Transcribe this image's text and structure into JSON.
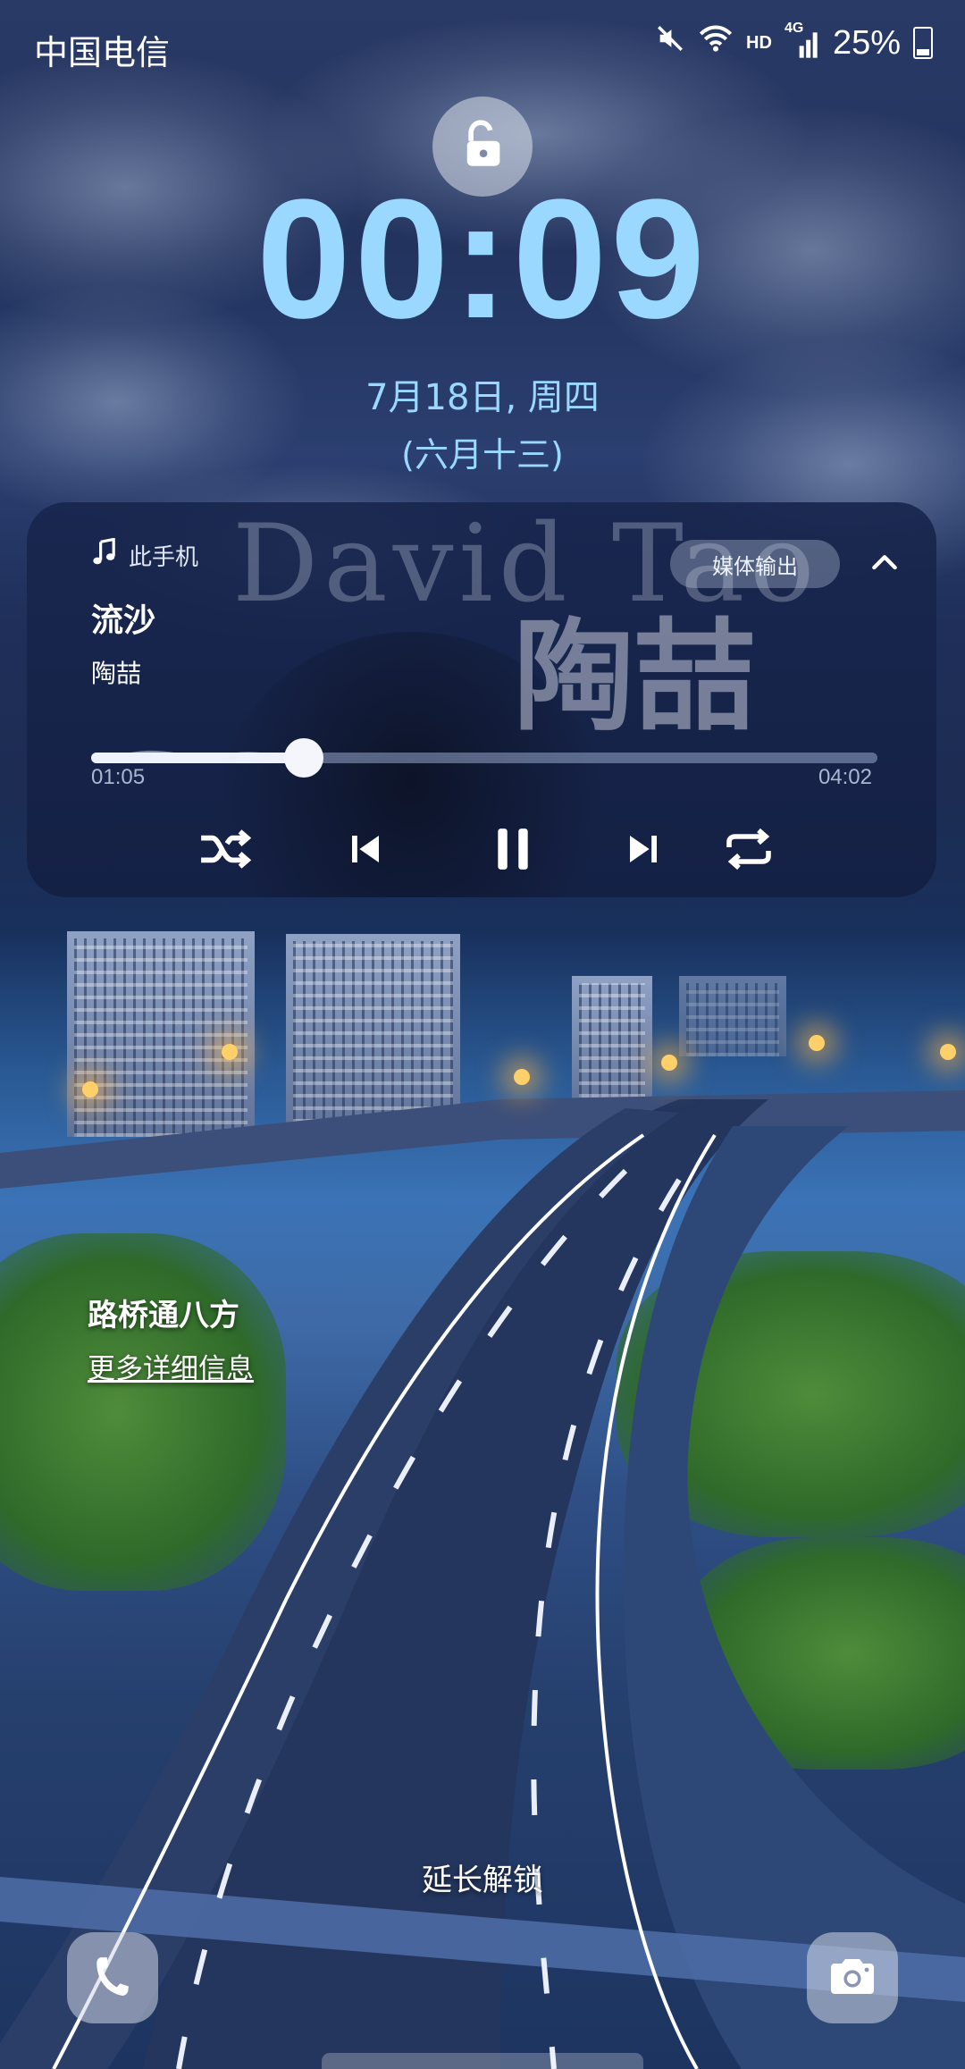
{
  "status_bar": {
    "carrier": "中国电信",
    "hd": "HD",
    "network": "4G",
    "battery_percent": "25%",
    "icons": [
      "mute-icon",
      "wifi-icon",
      "signal-icon",
      "battery-icon"
    ]
  },
  "lock": {
    "icon": "unlock-icon"
  },
  "clock": {
    "time": "00:09",
    "date": "7月18日, 周四",
    "lunar": "(六月十三)"
  },
  "media": {
    "source_label": "此手机",
    "output_button": "媒体输出",
    "song_title": "流沙",
    "artist": "陶喆",
    "elapsed": "01:05",
    "total": "04:02",
    "progress_fraction": 0.27,
    "album_art_text": "David Tao",
    "album_art_cn": "陶喆",
    "controls": [
      "shuffle-icon",
      "previous-icon",
      "pause-icon",
      "next-icon",
      "repeat-icon"
    ]
  },
  "wallpaper": {
    "title": "路桥通八方",
    "link": "更多详细信息"
  },
  "bottom": {
    "hint": "延长解锁",
    "left_shortcut": "phone-icon",
    "right_shortcut": "camera-icon"
  },
  "colors": {
    "clock": "#9ad8ff",
    "card_bg": "#18264e"
  }
}
